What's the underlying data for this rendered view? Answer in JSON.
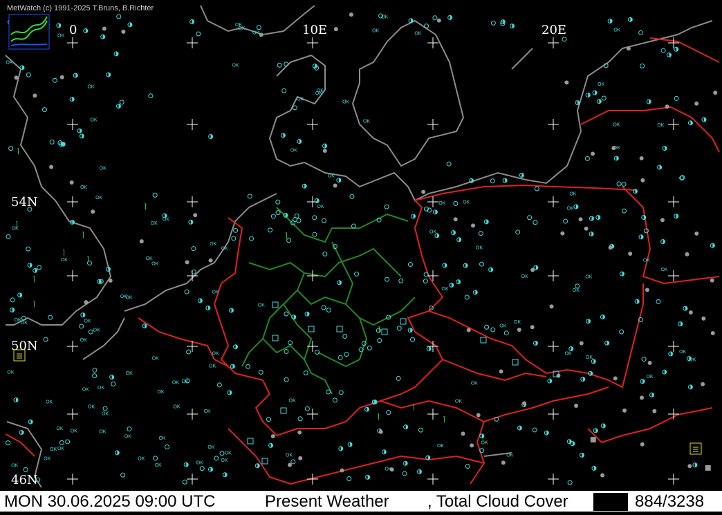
{
  "header": {
    "copyright": "MetWatch  (c) 1991-2025 T.Bruns, B.Richter",
    "logo_icon": "metwatch-logo-icon"
  },
  "map": {
    "longitude_labels": [
      "0",
      "10E",
      "20E"
    ],
    "latitude_labels": [
      "54N",
      "50N",
      "46N"
    ],
    "station_text": "OK",
    "colors": {
      "background": "#000000",
      "coastline": "#8c8c8c",
      "country_border": "#e02020",
      "state_border": "#1f8a1f",
      "station_clear": "#40e0e0",
      "station_missing": "#9a9a9a",
      "weather_symbol": "#30e030",
      "grid_cross": "#ffffff"
    }
  },
  "status": {
    "datetime": "MON 30.06.2025 09:00 UTC",
    "parameter_1": "Present Weather",
    "parameter_2": ", Total Cloud Cover",
    "station_count": "884/3238"
  }
}
